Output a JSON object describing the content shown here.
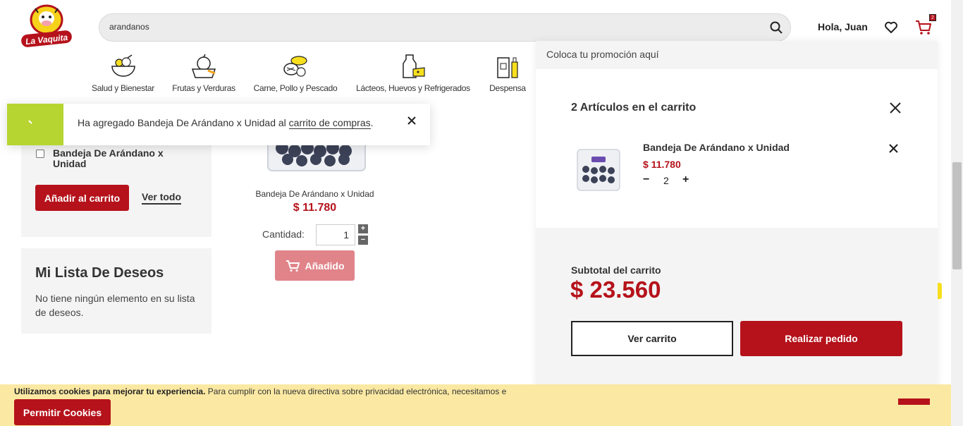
{
  "header": {
    "logo_text": "La Vaquita",
    "search_value": "arandanos",
    "greeting": "Hola, Juan",
    "cart_count": "2"
  },
  "categories": [
    {
      "label": "Salud y Bienestar",
      "icon": "salad-bowl-icon"
    },
    {
      "label": "Frutas y Verduras",
      "icon": "fruit-basket-icon"
    },
    {
      "label": "Carne, Pollo y Pescado",
      "icon": "meat-fish-icon"
    },
    {
      "label": "Lácteos, Huevos y Refrigerados",
      "icon": "milk-cheese-icon"
    },
    {
      "label": "Despensa",
      "icon": "pantry-icon"
    }
  ],
  "sidebar": {
    "compare_item": "Bandeja De Arándano x Unidad",
    "add_to_cart": "Añadir al carrito",
    "view_all": "Ver todo",
    "wishlist_title": "Mi Lista De Deseos",
    "wishlist_empty": "No tiene ningún elemento en su lista de deseos."
  },
  "product": {
    "name": "Bandeja De Arándano x Unidad",
    "price": "$ 11.780",
    "qty_label": "Cantidad:",
    "qty_value": "1",
    "added_label": "Añadido"
  },
  "toast": {
    "message_prefix": "Ha agregado Bandeja De Arándano x Unidad al ",
    "link": "carrito de compras",
    "suffix": "."
  },
  "minicart": {
    "promo": "Coloca tu promoción aquí",
    "title": "2 Artículos en el carrito",
    "item": {
      "name": "Bandeja De Arándano x Unidad",
      "price": "$ 11.780",
      "qty": "2",
      "minus": "−",
      "plus": "+"
    },
    "subtotal_label": "Subtotal del carrito",
    "subtotal_value": "$ 23.560",
    "view_cart": "Ver carrito",
    "checkout": "Realizar pedido"
  },
  "cookies": {
    "bold": "Utilizamos cookies para mejorar tu experiencia.",
    "text": " Para cumplir con la nueva directiva sobre privacidad electrónica, necesitamos e",
    "button": "Permitir Cookies"
  },
  "colors": {
    "brand_red": "#b5121b",
    "accent_green": "#b6d531",
    "cookie_bg": "#fbe9a3"
  }
}
